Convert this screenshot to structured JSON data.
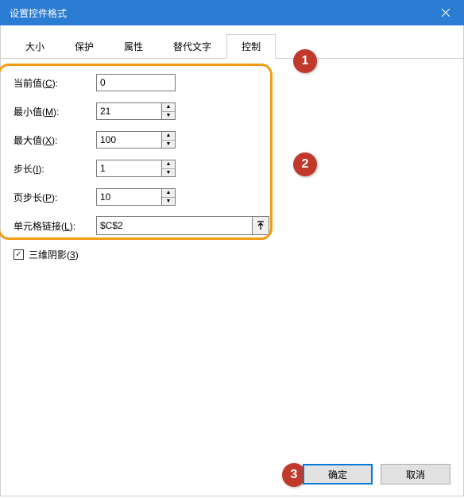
{
  "title": "设置控件格式",
  "tabs": {
    "size": "大小",
    "protect": "保护",
    "property": "属性",
    "alttext": "替代文字",
    "control": "控制"
  },
  "labels": {
    "current": "当前值",
    "current_u": "C",
    "min": "最小值",
    "min_u": "M",
    "max": "最大值",
    "max_u": "X",
    "step": "步长",
    "step_u": "I",
    "pagestep": "页步长",
    "pagestep_u": "P",
    "celllink": "单元格链接",
    "celllink_u": "L",
    "shadow3d": "三维阴影",
    "shadow3d_u": "3"
  },
  "values": {
    "current": "0",
    "min": "21",
    "max": "100",
    "step": "1",
    "pagestep": "10",
    "celllink": "$C$2"
  },
  "shadow3d_checked": true,
  "buttons": {
    "ok": "确定",
    "cancel": "取消"
  },
  "callouts": {
    "c1": "1",
    "c2": "2",
    "c3": "3"
  }
}
